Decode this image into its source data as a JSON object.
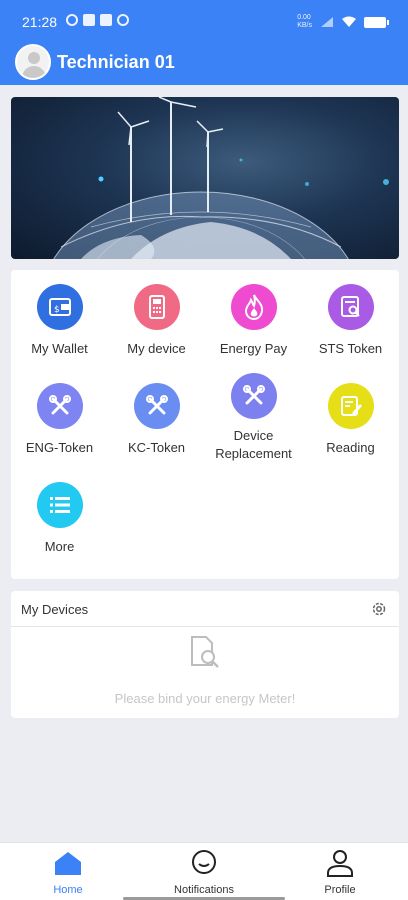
{
  "status_bar": {
    "time": "21:28",
    "net_speed": "0.00\nKB/s"
  },
  "header": {
    "username": "Technician 01"
  },
  "menu": [
    {
      "label": "My Wallet",
      "icon": "wallet-icon",
      "color": "#2f6fe0"
    },
    {
      "label": "My device",
      "icon": "device-icon",
      "color": "#f06a85"
    },
    {
      "label": "Energy Pay",
      "icon": "flame-icon",
      "color": "#ee4bd0"
    },
    {
      "label": "STS Token",
      "icon": "token-search-icon",
      "color": "#a95be6"
    },
    {
      "label": "ENG-Token",
      "icon": "tools-icon",
      "color": "#7e84f2"
    },
    {
      "label": "KC-Token",
      "icon": "tools-icon",
      "color": "#6a8df2"
    },
    {
      "label": "Device\nReplacement",
      "icon": "tools-icon",
      "color": "#7d80ef"
    },
    {
      "label": "Reading",
      "icon": "edit-icon",
      "color": "#e6df18"
    },
    {
      "label": "More",
      "icon": "list-icon",
      "color": "#22c9f0"
    }
  ],
  "my_devices": {
    "title": "My Devices",
    "empty_text": "Please bind your energy Meter!"
  },
  "bottom_nav": [
    {
      "label": "Home",
      "icon": "home-icon",
      "active": true
    },
    {
      "label": "Notifications",
      "icon": "chat-icon",
      "active": false
    },
    {
      "label": "Profile",
      "icon": "person-icon",
      "active": false
    }
  ],
  "colors": {
    "primary": "#3b82f6",
    "background": "#ecedf2"
  }
}
